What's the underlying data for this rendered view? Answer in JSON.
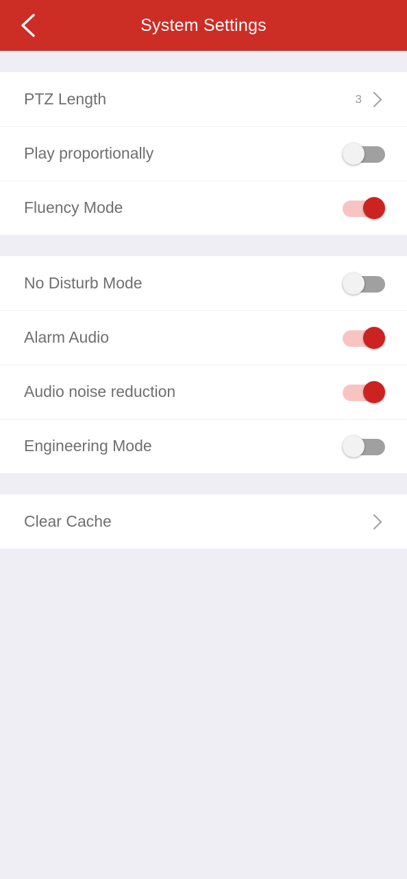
{
  "header": {
    "title": "System Settings",
    "back_icon": "chevron-left-icon",
    "background_color": "#cc2d25",
    "title_color": "#ffffff"
  },
  "theme": {
    "page_background": "#eeeef4",
    "row_background": "#ffffff",
    "label_color": "#6f6f6f",
    "value_color": "#9a9a9a",
    "accent_on": "#cc2220",
    "track_on": "#f7c4c1",
    "track_off": "#a0a0a0",
    "thumb_off": "#f2f2f2",
    "divider": "#f0f0f0"
  },
  "sections": [
    {
      "name": "playback-section",
      "rows": [
        {
          "name": "ptz-length",
          "label": "PTZ Length",
          "type": "value",
          "value": "3",
          "accessory": "chevron-right-icon"
        },
        {
          "name": "play-proportionally",
          "label": "Play proportionally",
          "type": "toggle",
          "state": "off"
        },
        {
          "name": "fluency-mode",
          "label": "Fluency Mode",
          "type": "toggle",
          "state": "on"
        }
      ]
    },
    {
      "name": "audio-section",
      "rows": [
        {
          "name": "no-disturb-mode",
          "label": "No Disturb Mode",
          "type": "toggle",
          "state": "off"
        },
        {
          "name": "alarm-audio",
          "label": "Alarm Audio",
          "type": "toggle",
          "state": "on"
        },
        {
          "name": "audio-noise-reduction",
          "label": "Audio noise reduction",
          "type": "toggle",
          "state": "on"
        },
        {
          "name": "engineering-mode",
          "label": "Engineering Mode",
          "type": "toggle",
          "state": "off"
        }
      ]
    },
    {
      "name": "storage-section",
      "rows": [
        {
          "name": "clear-cache",
          "label": "Clear Cache",
          "type": "link",
          "accessory": "chevron-right-icon"
        }
      ]
    }
  ]
}
